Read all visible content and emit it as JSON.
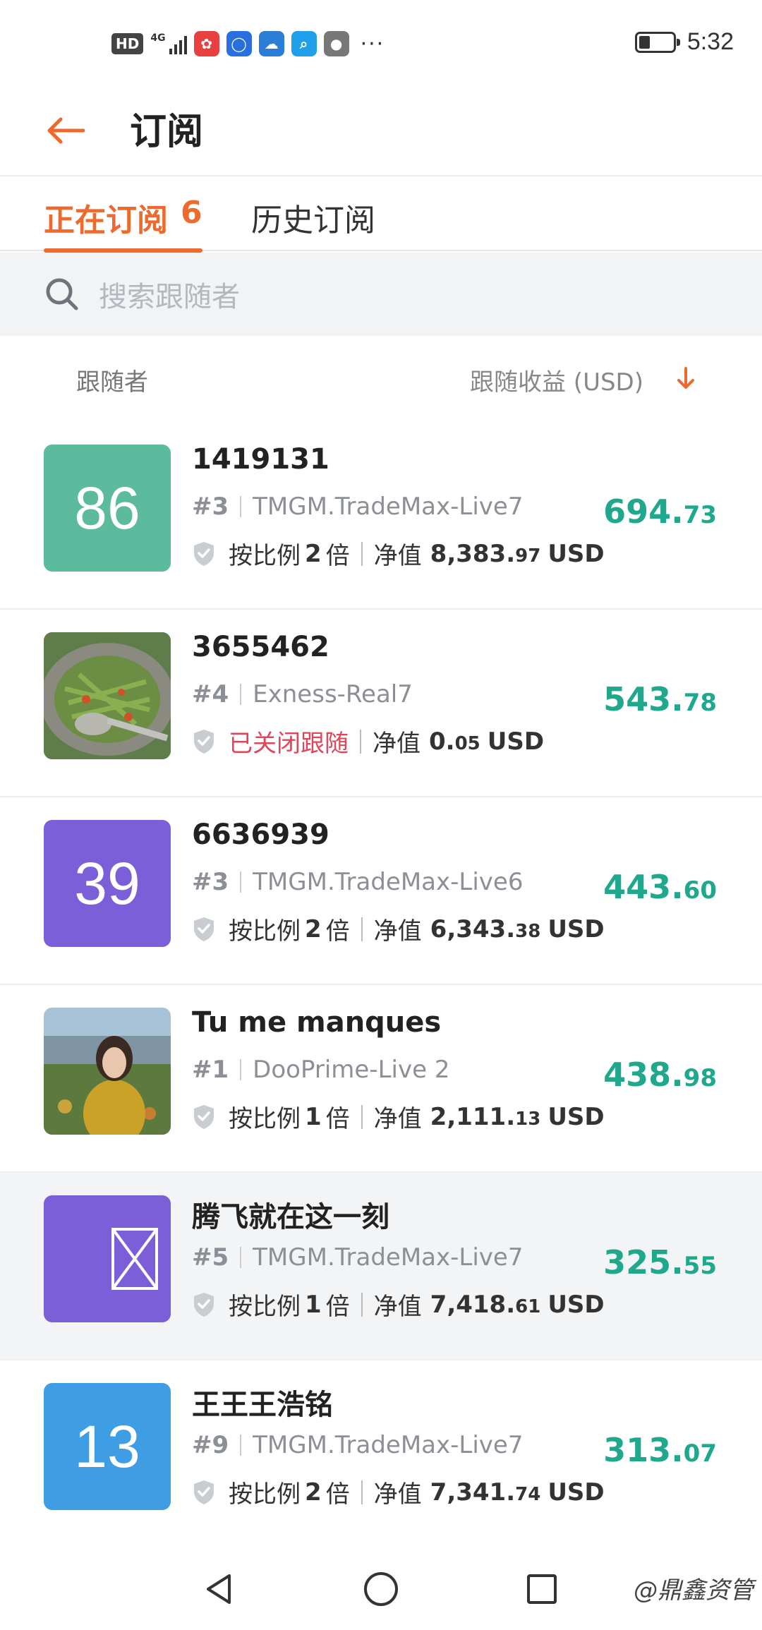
{
  "status_bar": {
    "hd": "HD",
    "network": "4G",
    "time": "5:32",
    "battery_fraction": 0.3,
    "apps": [
      {
        "icon": "gift-app-icon",
        "color": "#e84040",
        "glyph": "✿"
      },
      {
        "icon": "bulb-app-icon",
        "color": "#2a6fe0",
        "glyph": "◯"
      },
      {
        "icon": "weather-app-icon",
        "color": "#2b7ed8",
        "glyph": "☁"
      },
      {
        "icon": "search-app-icon",
        "color": "#1fa0e8",
        "glyph": "⌕"
      },
      {
        "icon": "ball-app-icon",
        "color": "#777777",
        "glyph": "●"
      }
    ],
    "more": "···"
  },
  "header": {
    "title": "订阅"
  },
  "tabs": {
    "active_label": "正在订阅",
    "active_count": "6",
    "history_label": "历史订阅"
  },
  "search": {
    "placeholder": "搜索跟随者"
  },
  "list_header": {
    "left": "跟随者",
    "right": "跟随收益 (USD)"
  },
  "colors": {
    "accent": "#ee6a2c",
    "profit": "#1fa88c",
    "closed": "#e0455a"
  },
  "followers": [
    {
      "avatar_type": "number",
      "avatar_text": "86",
      "avatar_color": "#5dbb9d",
      "name": "1419131",
      "rank": "#3",
      "server": "TMGM.TradeMax-Live7",
      "ratio_prefix": "按比例",
      "ratio_value": "2",
      "ratio_suffix": "倍",
      "closed_text": "",
      "equity_label": "净值",
      "equity_main": "8,383.",
      "equity_cents": "97",
      "currency": "USD",
      "profit_main": "694.",
      "profit_cents": "73",
      "highlight": false
    },
    {
      "avatar_type": "photo-food",
      "avatar_text": "",
      "avatar_color": "#6b8a55",
      "name": "3655462",
      "rank": "#4",
      "server": "Exness-Real7",
      "ratio_prefix": "",
      "ratio_value": "",
      "ratio_suffix": "",
      "closed_text": "已关闭跟随",
      "equity_label": "净值",
      "equity_main": "0.",
      "equity_cents": "05",
      "currency": "USD",
      "profit_main": "543.",
      "profit_cents": "78",
      "highlight": false
    },
    {
      "avatar_type": "number",
      "avatar_text": "39",
      "avatar_color": "#7b5fd9",
      "name": "6636939",
      "rank": "#3",
      "server": "TMGM.TradeMax-Live6",
      "ratio_prefix": "按比例",
      "ratio_value": "2",
      "ratio_suffix": "倍",
      "closed_text": "",
      "equity_label": "净值",
      "equity_main": "6,343.",
      "equity_cents": "38",
      "currency": "USD",
      "profit_main": "443.",
      "profit_cents": "60",
      "highlight": false
    },
    {
      "avatar_type": "photo-person",
      "avatar_text": "",
      "avatar_color": "#9bb7cf",
      "name": "Tu me manques",
      "rank": "#1",
      "server": "DooPrime-Live 2",
      "ratio_prefix": "按比例",
      "ratio_value": "1",
      "ratio_suffix": "倍",
      "closed_text": "",
      "equity_label": "净值",
      "equity_main": "2,111.",
      "equity_cents": "13",
      "currency": "USD",
      "profit_main": "438.",
      "profit_cents": "98",
      "highlight": false
    },
    {
      "avatar_type": "broken-image",
      "avatar_text": "",
      "avatar_color": "#7b5fd9",
      "name": "腾飞就在这一刻",
      "rank": "#5",
      "server": "TMGM.TradeMax-Live7",
      "ratio_prefix": "按比例",
      "ratio_value": "1",
      "ratio_suffix": "倍",
      "closed_text": "",
      "equity_label": "净值",
      "equity_main": "7,418.",
      "equity_cents": "61",
      "currency": "USD",
      "profit_main": "325.",
      "profit_cents": "55",
      "highlight": true
    },
    {
      "avatar_type": "number",
      "avatar_text": "13",
      "avatar_color": "#3f9ee3",
      "name": "王王王浩铭",
      "rank": "#9",
      "server": "TMGM.TradeMax-Live7",
      "ratio_prefix": "按比例",
      "ratio_value": "2",
      "ratio_suffix": "倍",
      "closed_text": "",
      "equity_label": "净值",
      "equity_main": "7,341.",
      "equity_cents": "74",
      "currency": "USD",
      "profit_main": "313.",
      "profit_cents": "07",
      "highlight": false
    }
  ],
  "nav": {
    "watermark": "@鼎鑫资管"
  }
}
